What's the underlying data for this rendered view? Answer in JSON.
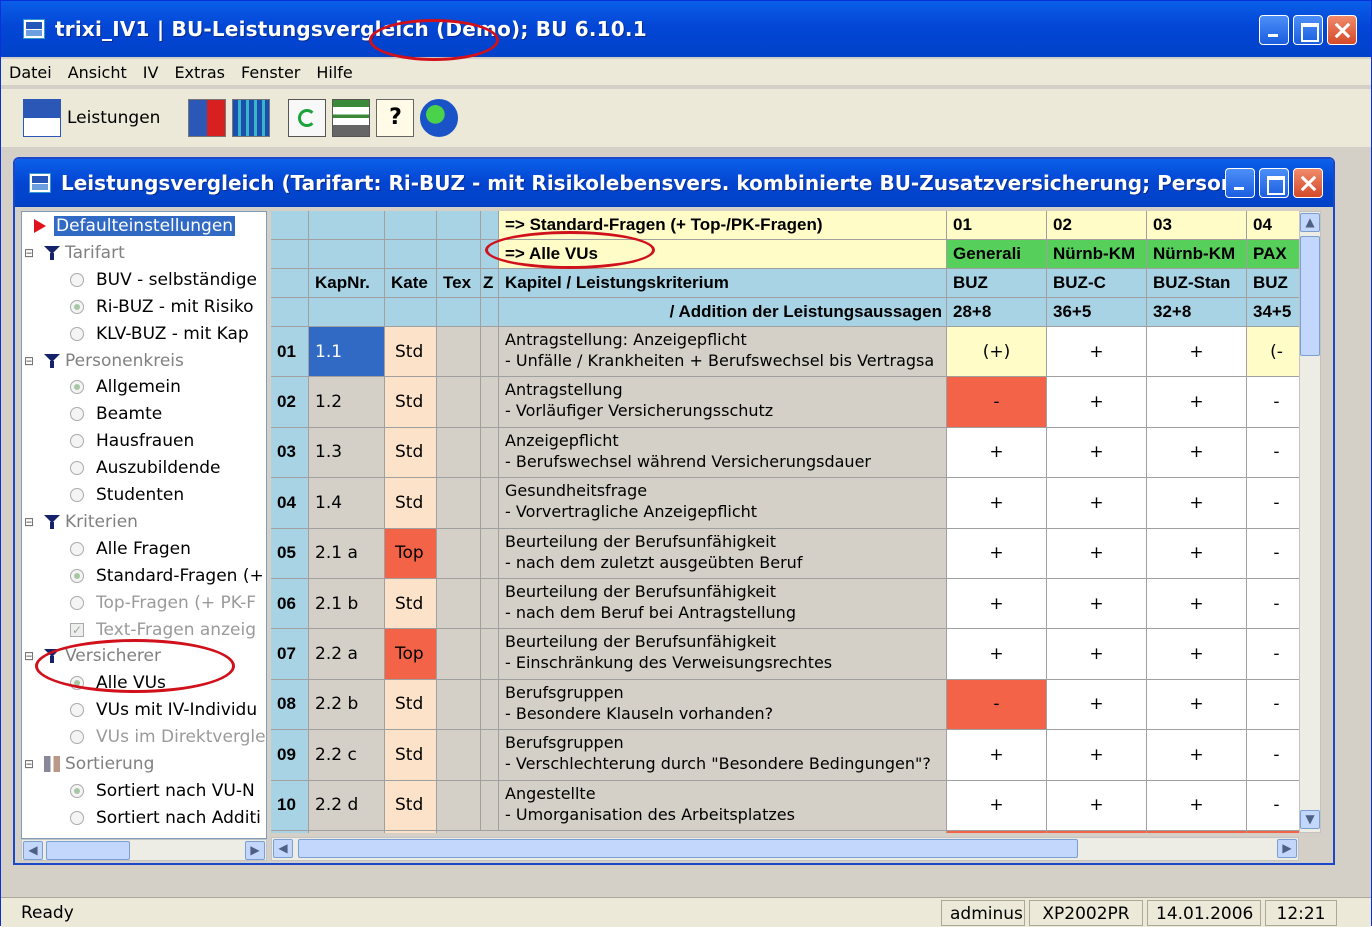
{
  "app": {
    "title": "trixi_IV1 | BU-Leistungsvergleich (Demo); BU 6.10.1"
  },
  "menu": [
    "Datei",
    "Ansicht",
    "IV",
    "Extras",
    "Fenster",
    "Hilfe"
  ],
  "toolbar": {
    "leistungen_label": "Leistungen",
    "icons": [
      "iv-bu-icon",
      "compare-icon",
      "table-icon",
      "refresh-icon",
      "report-icon",
      "help-icon",
      "globe-icon"
    ]
  },
  "mdi": {
    "title": "Leistungsvergleich (Tarifart: Ri-BUZ - mit Risikolebensvers. kombinierte BU-Zusatzversicherung; Personenk..."
  },
  "tree": [
    {
      "label": "Defaulteinstellungen",
      "type": "root",
      "selected": true
    },
    {
      "label": "Tarifart",
      "type": "group"
    },
    {
      "label": "BUV - selbständige",
      "type": "radio",
      "checked": false
    },
    {
      "label": "Ri-BUZ - mit Risiko",
      "type": "radio",
      "checked": true
    },
    {
      "label": "KLV-BUZ - mit Kap",
      "type": "radio",
      "checked": false
    },
    {
      "label": "Personenkreis",
      "type": "group"
    },
    {
      "label": "Allgemein",
      "type": "radio",
      "checked": true
    },
    {
      "label": "Beamte",
      "type": "radio",
      "checked": false
    },
    {
      "label": "Hausfrauen",
      "type": "radio",
      "checked": false
    },
    {
      "label": "Auszubildende",
      "type": "radio",
      "checked": false
    },
    {
      "label": "Studenten",
      "type": "radio",
      "checked": false
    },
    {
      "label": "Kriterien",
      "type": "group"
    },
    {
      "label": "Alle Fragen",
      "type": "radio",
      "checked": false
    },
    {
      "label": "Standard-Fragen (+",
      "type": "radio",
      "checked": true
    },
    {
      "label": "Top-Fragen (+ PK-F",
      "type": "radio",
      "checked": false,
      "disabled": true
    },
    {
      "label": "Text-Fragen anzeig",
      "type": "check",
      "checked": true,
      "disabled": true
    },
    {
      "label": "Versicherer",
      "type": "group"
    },
    {
      "label": "Alle VUs",
      "type": "radio",
      "checked": true
    },
    {
      "label": "VUs mit IV-Individu",
      "type": "radio",
      "checked": false
    },
    {
      "label": "VUs im Direktvergle",
      "type": "radio",
      "checked": false,
      "disabled": true
    },
    {
      "label": "Sortierung",
      "type": "group",
      "icon": "sort-icon"
    },
    {
      "label": "Sortiert nach VU-N",
      "type": "radio",
      "checked": true
    },
    {
      "label": "Sortiert nach Additi",
      "type": "radio",
      "checked": false
    }
  ],
  "grid": {
    "header": {
      "row1_label": "=> Standard-Fragen (+ Top-/PK-Fragen)",
      "row2_label": "=> Alle VUs",
      "col_kap": "KapNr.",
      "col_kat": "Kate",
      "col_tex": "Tex",
      "col_z": "Z",
      "col_kapitel": "Kapitel / Leistungskriterium",
      "addition_label": "/ Addition der Leistungsaussagen"
    },
    "vus": [
      {
        "nr": "01",
        "name": "Generali",
        "tarif": "BUZ",
        "sum": "28+8"
      },
      {
        "nr": "02",
        "name": "Nürnb-KM",
        "tarif": "BUZ-C",
        "sum": "36+5"
      },
      {
        "nr": "03",
        "name": "Nürnb-KM",
        "tarif": "BUZ-Stan",
        "sum": "32+8"
      },
      {
        "nr": "04",
        "name": "PAX",
        "tarif": "BUZ",
        "sum": "34+5"
      }
    ],
    "rows": [
      {
        "nr": "01",
        "kap": "1.1",
        "kat": "Std",
        "l1": "Antragstellung: Anzeigepflicht",
        "l2": "- Unfälle / Krankheiten + Berufswechsel bis  Vertragsa",
        "v": [
          "(+)",
          "+",
          "+",
          "(-"
        ]
      },
      {
        "nr": "02",
        "kap": "1.2",
        "kat": "Std",
        "l1": "Antragstellung",
        "l2": "- Vorläufiger Versicherungsschutz",
        "v": [
          "-",
          "+",
          "+",
          "-"
        ]
      },
      {
        "nr": "03",
        "kap": "1.3",
        "kat": "Std",
        "l1": "Anzeigepflicht",
        "l2": "- Berufswechsel  während Versicherungsdauer",
        "v": [
          "+",
          "+",
          "+",
          "-"
        ]
      },
      {
        "nr": "04",
        "kap": "1.4",
        "kat": "Std",
        "l1": "Gesundheitsfrage",
        "l2": "- Vorvertragliche Anzeigepflicht",
        "v": [
          "+",
          "+",
          "+",
          "-"
        ]
      },
      {
        "nr": "05",
        "kap": "2.1 a",
        "kat": "Top",
        "l1": "Beurteilung der Berufsunfähigkeit",
        "l2": "- nach dem zuletzt ausgeübten Beruf",
        "v": [
          "+",
          "+",
          "+",
          "-"
        ]
      },
      {
        "nr": "06",
        "kap": "2.1 b",
        "kat": "Std",
        "l1": "Beurteilung der Berufsunfähigkeit",
        "l2": "- nach dem Beruf bei Antragstellung",
        "v": [
          "+",
          "+",
          "+",
          "-"
        ]
      },
      {
        "nr": "07",
        "kap": "2.2 a",
        "kat": "Top",
        "l1": "Beurteilung der Berufsunfähigkeit",
        "l2": "- Einschränkung des Verweisungsrechtes",
        "v": [
          "+",
          "+",
          "+",
          "-"
        ]
      },
      {
        "nr": "08",
        "kap": "2.2 b",
        "kat": "Std",
        "l1": "Berufsgruppen",
        "l2": "- Besondere Klauseln vorhanden?",
        "v": [
          "-",
          "+",
          "+",
          "-"
        ]
      },
      {
        "nr": "09",
        "kap": "2.2 c",
        "kat": "Std",
        "l1": "Berufsgruppen",
        "l2": "- Verschlechterung durch \"Besondere Bedingungen\"?",
        "v": [
          "+",
          "+",
          "+",
          "-"
        ]
      },
      {
        "nr": "10",
        "kap": "2.2 d",
        "kat": "Std",
        "l1": "Angestellte",
        "l2": "- Umorganisation  des Arbeitsplatzes",
        "v": [
          "+",
          "+",
          "+",
          "-"
        ]
      }
    ]
  },
  "status": {
    "ready": "Ready",
    "user": "adminus",
    "machine": "XP2002PR",
    "date": "14.01.2006",
    "time": "12:21"
  },
  "colors": {
    "accent": "#316ac5",
    "header_blue": "#a7d3e4",
    "vu_green": "#56d05b",
    "top_red": "#f26348",
    "std_peach": "#fce2c8",
    "annotation_red": "#d0101a"
  }
}
